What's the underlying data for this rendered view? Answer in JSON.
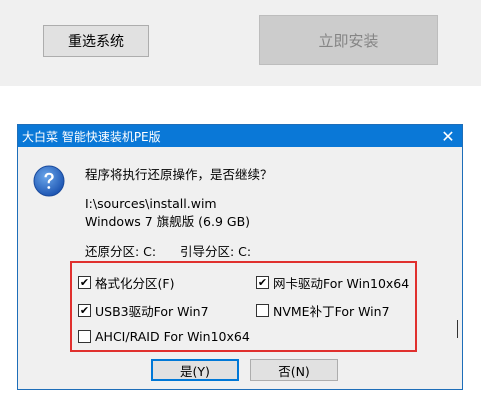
{
  "background": {
    "reselect_label": "重选系统",
    "install_label": "立即安装"
  },
  "dialog": {
    "title": "大白菜 智能快速装机PE版",
    "close_glyph": "✕",
    "message": "程序将执行还原操作，是否继续？",
    "image_path": "I:\\sources\\install.wim",
    "os_info": "Windows 7 旗舰版 (6.9 GB)",
    "restore_partition": "还原分区: C:",
    "boot_partition": "引导分区: C:",
    "options": [
      {
        "label": "格式化分区(F)",
        "checked": true
      },
      {
        "label": "网卡驱动For Win10x64",
        "checked": true
      },
      {
        "label": "USB3驱动For Win7",
        "checked": true
      },
      {
        "label": "NVME补丁For Win7",
        "checked": false
      },
      {
        "label": "AHCI/RAID For Win10x64",
        "checked": false
      }
    ],
    "yes_label": "是(Y)",
    "no_label": "否(N)",
    "check_glyph": "✔",
    "icon": "question-icon",
    "accent_color": "#0a78d7",
    "highlight_color": "#e0302e"
  }
}
